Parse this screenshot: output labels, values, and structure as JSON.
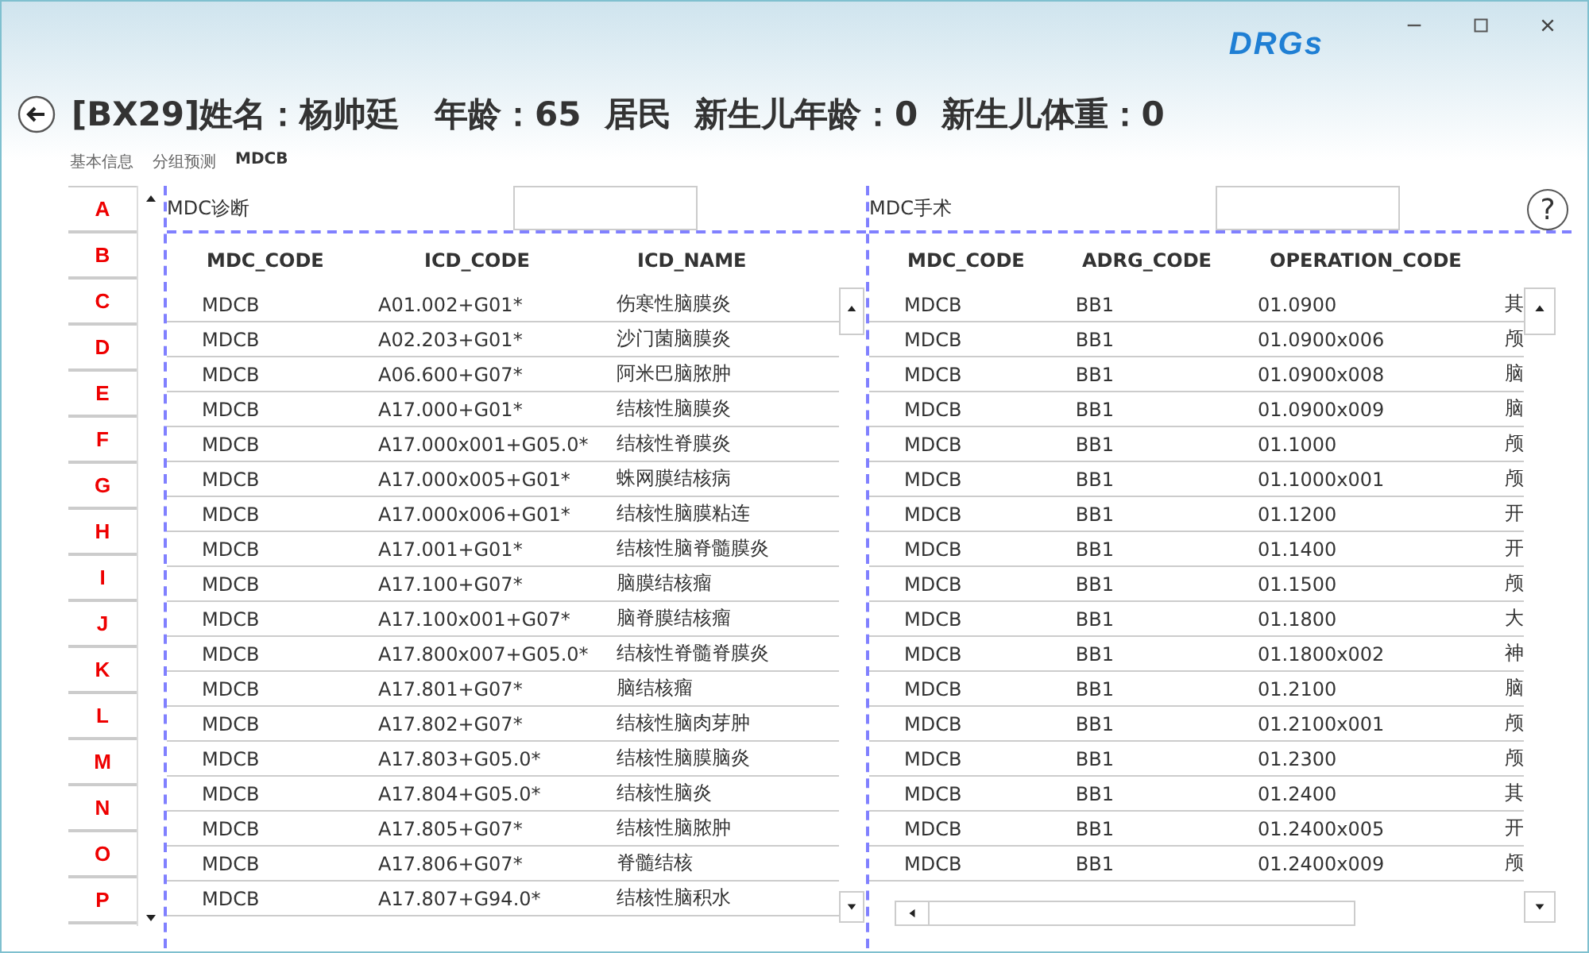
{
  "window": {
    "logo": "DRGs"
  },
  "title": "[BX29]姓名：杨帅廷   年龄：65  居民  新生儿年龄：0  新生儿体重：0",
  "breadcrumb": [
    {
      "label": "基本信息",
      "selected": false
    },
    {
      "label": "分组预测",
      "selected": false
    },
    {
      "label": "MDCB",
      "selected": true
    }
  ],
  "letters": [
    "A",
    "B",
    "C",
    "D",
    "E",
    "F",
    "G",
    "H",
    "I",
    "J",
    "K",
    "L",
    "M",
    "N",
    "O",
    "P"
  ],
  "diagnosis": {
    "label": "MDC诊断",
    "columns": [
      "MDC_CODE",
      "ICD_CODE",
      "ICD_NAME"
    ],
    "rows": [
      [
        "MDCB",
        "A01.002+G01*",
        "伤寒性脑膜炎"
      ],
      [
        "MDCB",
        "A02.203+G01*",
        "沙门菌脑膜炎"
      ],
      [
        "MDCB",
        "A06.600+G07*",
        "阿米巴脑脓肿"
      ],
      [
        "MDCB",
        "A17.000+G01*",
        "结核性脑膜炎"
      ],
      [
        "MDCB",
        "A17.000x001+G05.0*",
        "结核性脊膜炎"
      ],
      [
        "MDCB",
        "A17.000x005+G01*",
        "蛛网膜结核病"
      ],
      [
        "MDCB",
        "A17.000x006+G01*",
        "结核性脑膜粘连"
      ],
      [
        "MDCB",
        "A17.001+G01*",
        "结核性脑脊髓膜炎"
      ],
      [
        "MDCB",
        "A17.100+G07*",
        "脑膜结核瘤"
      ],
      [
        "MDCB",
        "A17.100x001+G07*",
        "脑脊膜结核瘤"
      ],
      [
        "MDCB",
        "A17.800x007+G05.0*",
        "结核性脊髓脊膜炎"
      ],
      [
        "MDCB",
        "A17.801+G07*",
        "脑结核瘤"
      ],
      [
        "MDCB",
        "A17.802+G07*",
        "结核性脑肉芽肿"
      ],
      [
        "MDCB",
        "A17.803+G05.0*",
        "结核性脑膜脑炎"
      ],
      [
        "MDCB",
        "A17.804+G05.0*",
        "结核性脑炎"
      ],
      [
        "MDCB",
        "A17.805+G07*",
        "结核性脑脓肿"
      ],
      [
        "MDCB",
        "A17.806+G07*",
        "脊髓结核"
      ],
      [
        "MDCB",
        "A17.807+G94.0*",
        "结核性脑积水"
      ]
    ]
  },
  "surgery": {
    "label": "MDC手术",
    "help": "?",
    "columns": [
      "MDC_CODE",
      "ADRG_CODE",
      "OPERATION_CODE"
    ],
    "rows": [
      [
        "MDCB",
        "BB1",
        "01.0900",
        "其"
      ],
      [
        "MDCB",
        "BB1",
        "01.0900x006",
        "颅"
      ],
      [
        "MDCB",
        "BB1",
        "01.0900x008",
        "脑"
      ],
      [
        "MDCB",
        "BB1",
        "01.0900x009",
        "脑"
      ],
      [
        "MDCB",
        "BB1",
        "01.1000",
        "颅"
      ],
      [
        "MDCB",
        "BB1",
        "01.1000x001",
        "颅"
      ],
      [
        "MDCB",
        "BB1",
        "01.1200",
        "开"
      ],
      [
        "MDCB",
        "BB1",
        "01.1400",
        "开"
      ],
      [
        "MDCB",
        "BB1",
        "01.1500",
        "颅"
      ],
      [
        "MDCB",
        "BB1",
        "01.1800",
        "大"
      ],
      [
        "MDCB",
        "BB1",
        "01.1800x002",
        "神"
      ],
      [
        "MDCB",
        "BB1",
        "01.2100",
        "脑"
      ],
      [
        "MDCB",
        "BB1",
        "01.2100x001",
        "颅"
      ],
      [
        "MDCB",
        "BB1",
        "01.2300",
        "颅"
      ],
      [
        "MDCB",
        "BB1",
        "01.2400",
        "其"
      ],
      [
        "MDCB",
        "BB1",
        "01.2400x005",
        "开"
      ],
      [
        "MDCB",
        "BB1",
        "01.2400x009",
        "颅"
      ]
    ]
  }
}
